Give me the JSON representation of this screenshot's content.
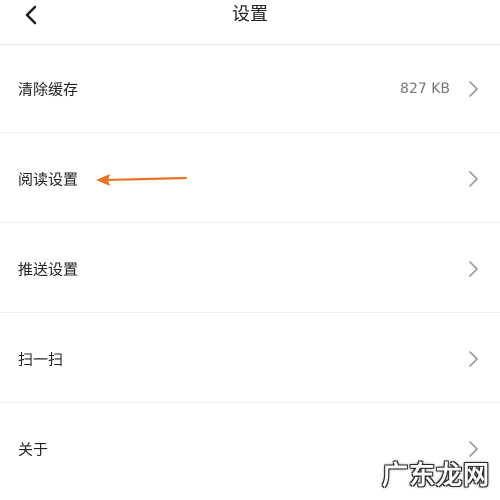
{
  "header": {
    "title": "设置",
    "back_icon": "chevron-left-icon"
  },
  "settings": {
    "items": [
      {
        "label": "清除缓存",
        "value": "827 KB",
        "icon": "chevron-right-icon"
      },
      {
        "label": "阅读设置",
        "value": "",
        "icon": "chevron-right-icon"
      },
      {
        "label": "推送设置",
        "value": "",
        "icon": "chevron-right-icon"
      },
      {
        "label": "扫一扫",
        "value": "",
        "icon": "chevron-right-icon"
      },
      {
        "label": "关于",
        "value": "",
        "icon": "chevron-right-icon"
      }
    ]
  },
  "annotation": {
    "arrow_color": "#e8742a",
    "points_to": "阅读设置"
  },
  "watermark": {
    "text": "广东龙网"
  },
  "colors": {
    "background": "#ffffff",
    "divider": "#ededed",
    "chevron": "#9a9a9a",
    "arrow": "#e8742a"
  }
}
